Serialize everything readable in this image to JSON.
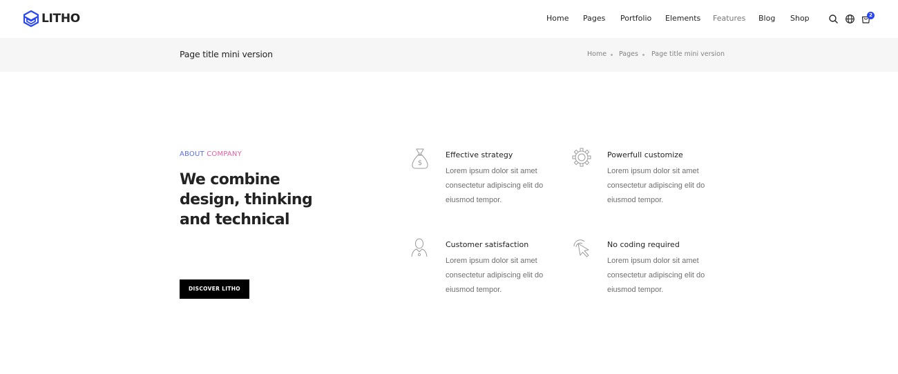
{
  "brand": {
    "name": "LITHO",
    "accent": "#2946f3"
  },
  "nav": {
    "items": [
      {
        "label": "Home",
        "icon": ""
      },
      {
        "label": "Pages",
        "icon": ""
      },
      {
        "label": "Portfolio",
        "icon": ""
      },
      {
        "label": "Elements",
        "icon": ""
      },
      {
        "label": "Features",
        "icon": ""
      },
      {
        "label": "Blog",
        "icon": ""
      },
      {
        "label": "Shop",
        "icon": ""
      }
    ],
    "icons": [
      "search-icon",
      "globe-icon",
      "cart-icon"
    ],
    "cart_count": "2"
  },
  "titlebar": {
    "title": "Page title mini version",
    "breadcrumb": [
      "Home",
      "Pages",
      "Page title mini version"
    ]
  },
  "about": {
    "eyebrow_part1": "ABOUT",
    "eyebrow_part2": "COMPANY",
    "headline": [
      "We combine",
      "design, thinking",
      "and technical"
    ],
    "button_label": "DISCOVER LITHO"
  },
  "features": [
    {
      "icon": "money-bag-icon",
      "title": "Effective strategy",
      "desc": [
        "Lorem ipsum dolor sit amet",
        "consectetur adipiscing elit do",
        "eiusmod tempor."
      ]
    },
    {
      "icon": "gear-icon",
      "title": "Powerfull customize",
      "desc": [
        "Lorem ipsum dolor sit amet",
        "consectetur adipiscing elit do",
        "eiusmod tempor."
      ]
    },
    {
      "icon": "user-icon",
      "title": "Customer satisfaction",
      "desc": [
        "Lorem ipsum dolor sit amet",
        "consectetur adipiscing elit do",
        "eiusmod tempor."
      ]
    },
    {
      "icon": "pointer-click-icon",
      "title": "No coding required",
      "desc": [
        "Lorem ipsum dolor sit amet",
        "consectetur adipiscing elit do",
        "eiusmod tempor."
      ]
    }
  ]
}
